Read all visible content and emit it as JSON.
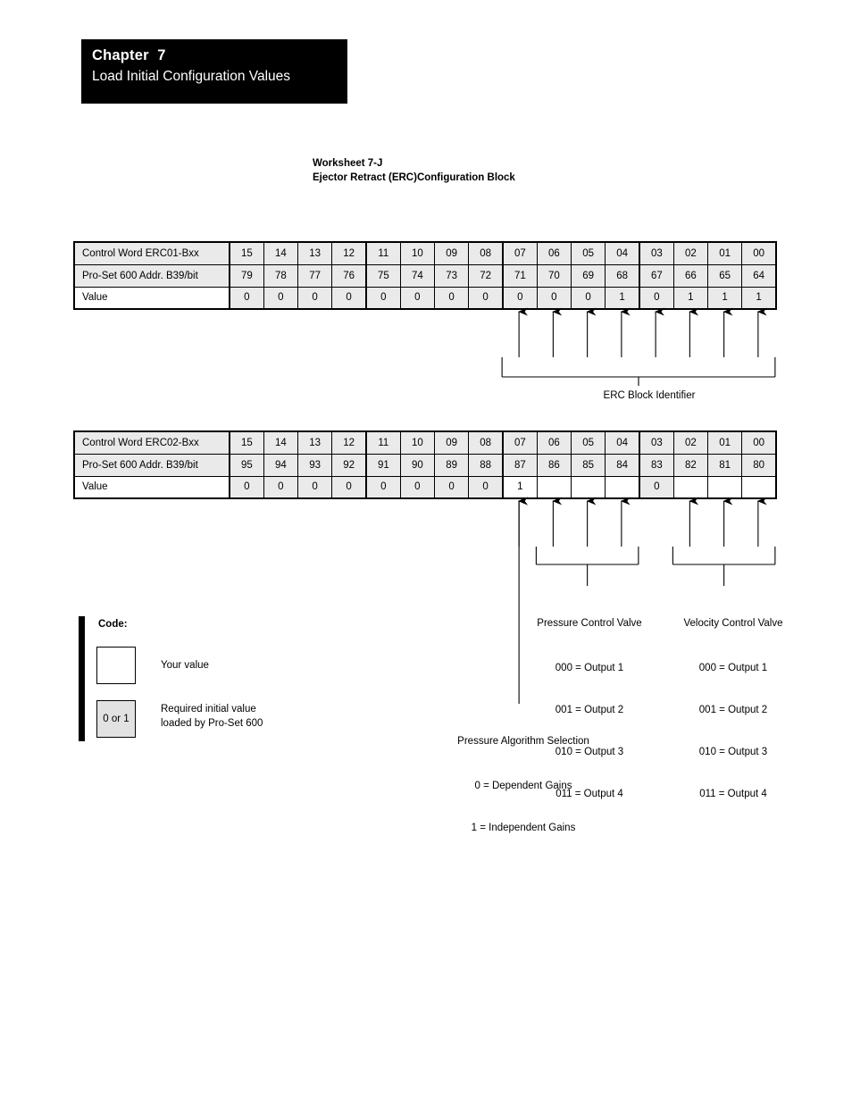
{
  "chapter": {
    "label": "Chapter  7",
    "title": "Load Initial Configuration Values"
  },
  "worksheet": {
    "number": "Worksheet 7-J",
    "name": "Ejector Retract (ERC)Configuration Block"
  },
  "tables": [
    {
      "id": "table1",
      "row_labels": {
        "control_word": "Control Word ERC01-Bxx",
        "address": "Pro-Set 600 Addr. B39/bit",
        "value": "Value"
      },
      "bits": [
        "15",
        "14",
        "13",
        "12",
        "11",
        "10",
        "09",
        "08",
        "07",
        "06",
        "05",
        "04",
        "03",
        "02",
        "01",
        "00"
      ],
      "addresses": [
        "79",
        "78",
        "77",
        "76",
        "75",
        "74",
        "73",
        "72",
        "71",
        "70",
        "69",
        "68",
        "67",
        "66",
        "65",
        "64"
      ],
      "values": [
        "0",
        "0",
        "0",
        "0",
        "0",
        "0",
        "0",
        "0",
        "0",
        "0",
        "0",
        "1",
        "0",
        "1",
        "1",
        "1"
      ],
      "value_kinds": [
        "req",
        "req",
        "req",
        "req",
        "req",
        "req",
        "req",
        "req",
        "req",
        "req",
        "req",
        "req",
        "req",
        "req",
        "req",
        "req"
      ]
    },
    {
      "id": "table2",
      "row_labels": {
        "control_word": "Control Word ERC02-Bxx",
        "address": "Pro-Set 600 Addr. B39/bit",
        "value": "Value"
      },
      "bits": [
        "15",
        "14",
        "13",
        "12",
        "11",
        "10",
        "09",
        "08",
        "07",
        "06",
        "05",
        "04",
        "03",
        "02",
        "01",
        "00"
      ],
      "addresses": [
        "95",
        "94",
        "93",
        "92",
        "91",
        "90",
        "89",
        "88",
        "87",
        "86",
        "85",
        "84",
        "83",
        "82",
        "81",
        "80"
      ],
      "values": [
        "0",
        "0",
        "0",
        "0",
        "0",
        "0",
        "0",
        "0",
        "1",
        "",
        "",
        "",
        "0",
        "",
        "",
        ""
      ],
      "value_kinds": [
        "req",
        "req",
        "req",
        "req",
        "req",
        "req",
        "req",
        "req",
        "your",
        "your",
        "your",
        "your",
        "req",
        "your",
        "your",
        "your"
      ]
    }
  ],
  "callouts": {
    "erc_block_identifier": "ERC Block Identifier",
    "pressure_control_valve": {
      "heading": "Pressure Control Valve",
      "options": [
        "000 = Output 1",
        "001 = Output 2",
        "010 = Output 3",
        "011 = Output 4"
      ]
    },
    "velocity_control_valve": {
      "heading": "Velocity Control Valve",
      "options": [
        "000 = Output 1",
        "001 = Output 2",
        "010 = Output 3",
        "011 = Output 4"
      ]
    },
    "pressure_algorithm_selection": {
      "heading": "Pressure Algorithm Selection",
      "options": [
        "0 = Dependent Gains",
        "1 = Independent Gains"
      ]
    }
  },
  "code_legend": {
    "title": "Code:",
    "your_value_swatch": "",
    "your_value_text": "Your value",
    "required_swatch": "0 or 1",
    "required_text": "Required initial value\nloaded by Pro-Set 600"
  }
}
